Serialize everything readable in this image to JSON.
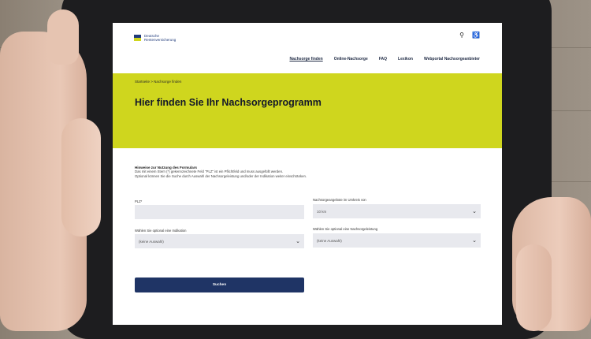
{
  "photo": {
    "subject": "tablet-held-by-two-hands"
  },
  "site": {
    "logo_line1": "Deutsche",
    "logo_line2": "Rentenversicherung",
    "flag_colors": [
      "#1f3a7a",
      "#cfd61e"
    ],
    "header_icons": [
      "language-icon",
      "accessibility-icon"
    ],
    "nav": [
      "Nachsorge finden",
      "Online-Nachsorge",
      "FAQ",
      "Lexikon",
      "Webportal Nachsorgeanbieter"
    ],
    "breadcrumb": "Startseite  >  Nachsorge finden",
    "headline": "Hier finden Sie Ihr Nachsorgeprogramm",
    "banner_color": "#cfd61e"
  },
  "form": {
    "hint_title": "Hinweise zur Nutzung des Formulars",
    "hint_line1": "Das mit einem Stern (*) gekennzeichnete Feld \"PLZ\" ist ein Pflichtfeld und muss ausgefüllt werden.",
    "hint_line2": "Optional können Sie die Suche durch Auswahl der Nachsorgeleistung und/oder der Indikation weiter einschränken.",
    "plz_label": "PLZ*",
    "plz_value": "",
    "radius_label": "Nachsorgeangebote im Umkreis von",
    "radius_value": "10 km",
    "indication_label": "Wählen Sie optional eine Indikation",
    "indication_value": "(keine Auswahl)",
    "service_label": "Wählen Sie optional eine Nachsorgeleistung",
    "service_value": "(keine Auswahl)",
    "submit_label": "Suchen",
    "button_color": "#1f3465"
  }
}
